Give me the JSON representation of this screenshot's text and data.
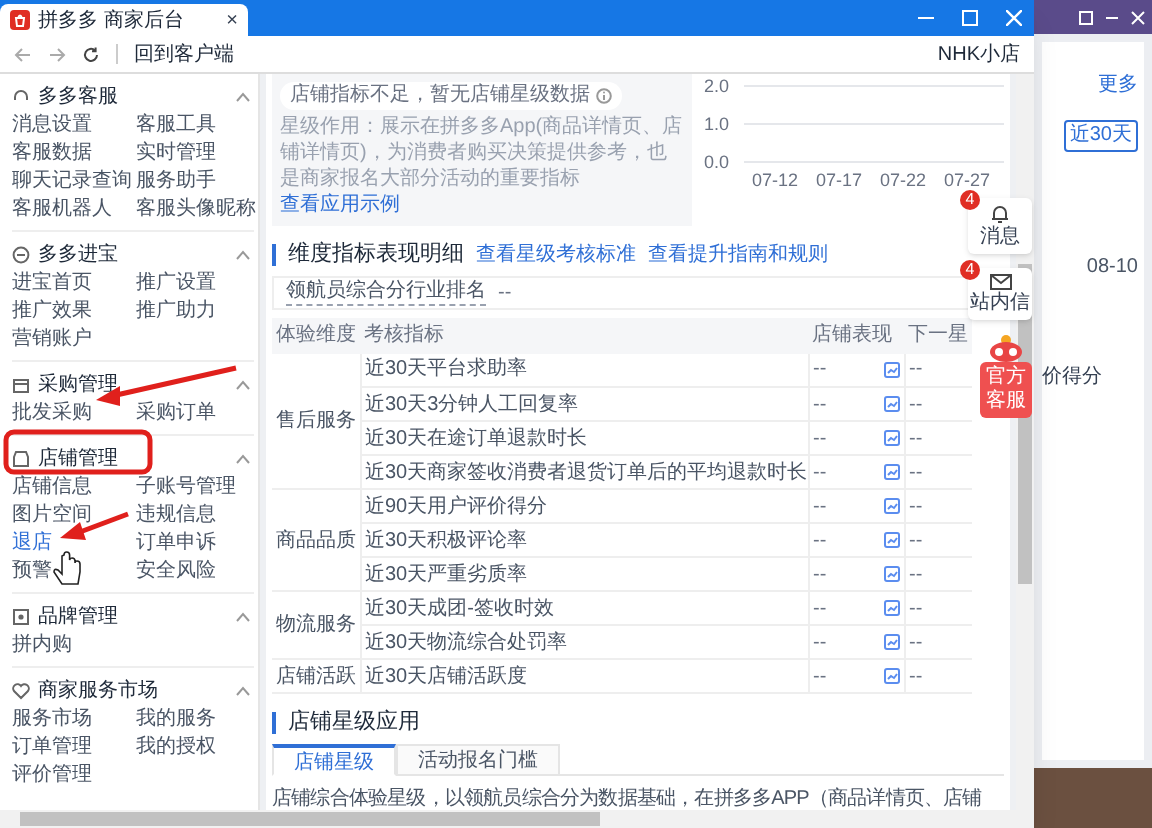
{
  "window": {
    "title": "拼多多 商家后台",
    "close": "×"
  },
  "toolbar": {
    "back_link": "回到客户端",
    "shop_name": "NHK小店"
  },
  "sidebar": {
    "sections": [
      {
        "title": "多多客服",
        "expanded": true,
        "items": [
          {
            "label": "消息设置",
            "selected": false
          },
          {
            "label": "客服工具",
            "selected": false
          },
          {
            "label": "客服数据",
            "selected": false
          },
          {
            "label": "实时管理",
            "selected": false
          },
          {
            "label": "聊天记录查询",
            "selected": false
          },
          {
            "label": "服务助手",
            "selected": false
          },
          {
            "label": "客服机器人",
            "selected": false
          },
          {
            "label": "客服头像昵称",
            "selected": false
          }
        ]
      },
      {
        "title": "多多进宝",
        "expanded": true,
        "items": [
          {
            "label": "进宝首页",
            "selected": false
          },
          {
            "label": "推广设置",
            "selected": false
          },
          {
            "label": "推广效果",
            "selected": false
          },
          {
            "label": "推广助力",
            "selected": false
          },
          {
            "label": "营销账户",
            "selected": false
          }
        ]
      },
      {
        "title": "采购管理",
        "expanded": true,
        "items": [
          {
            "label": "批发采购",
            "selected": false
          },
          {
            "label": "采购订单",
            "selected": false
          }
        ]
      },
      {
        "title": "店铺管理",
        "expanded": true,
        "items": [
          {
            "label": "店铺信息",
            "selected": false
          },
          {
            "label": "子账号管理",
            "selected": false
          },
          {
            "label": "图片空间",
            "selected": false
          },
          {
            "label": "违规信息",
            "selected": false
          },
          {
            "label": "退店",
            "selected": true
          },
          {
            "label": "订单申诉",
            "selected": false
          },
          {
            "label": "预警",
            "selected": false
          },
          {
            "label": "安全风险",
            "selected": false
          }
        ]
      },
      {
        "title": "品牌管理",
        "expanded": true,
        "items": [
          {
            "label": "拼内购",
            "selected": false
          }
        ]
      },
      {
        "title": "商家服务市场",
        "expanded": true,
        "items": [
          {
            "label": "服务市场",
            "selected": false
          },
          {
            "label": "我的服务",
            "selected": false
          },
          {
            "label": "订单管理",
            "selected": false
          },
          {
            "label": "我的授权",
            "selected": false
          },
          {
            "label": "评价管理",
            "selected": false
          }
        ]
      }
    ]
  },
  "star_panel": {
    "notice": "店铺指标不足，暂无店铺星级数据",
    "description": "星级作用：展示在拼多多App(商品详情页、店铺详情页)，为消费者购买决策提供参考，也是商家报名大部分活动的重要指标",
    "link": "查看应用示例",
    "chart_data": {
      "type": "line",
      "ylim": [
        0,
        2
      ],
      "categories": [
        "07-12",
        "07-17",
        "07-22",
        "07-27"
      ],
      "yticks": [
        {
          "value": 0,
          "label": "0.0"
        },
        {
          "value": 1,
          "label": "1.0"
        },
        {
          "value": 2,
          "label": "2.0"
        }
      ]
    }
  },
  "metrics": {
    "title": "维度指标表现明细",
    "links": [
      "查看星级考核标准",
      "查看提升指南和规则"
    ],
    "ranking_label": "领航员综合分行业排名",
    "ranking_value": "--",
    "columns": [
      "体验维度",
      "考核指标",
      "店铺表现",
      "下一星"
    ],
    "groups": [
      {
        "dimension": "售后服务",
        "rows": [
          {
            "metric": "近30天平台求助率",
            "value": "--",
            "next": "--"
          },
          {
            "metric": "近30天3分钟人工回复率",
            "value": "--",
            "next": "--"
          },
          {
            "metric": "近30天在途订单退款时长",
            "value": "--",
            "next": "--"
          },
          {
            "metric": "近30天商家签收消费者退货订单后的平均退款时长",
            "value": "--",
            "next": "--"
          }
        ]
      },
      {
        "dimension": "商品品质",
        "rows": [
          {
            "metric": "近90天用户评价得分",
            "value": "--",
            "next": "--"
          },
          {
            "metric": "近30天积极评论率",
            "value": "--",
            "next": "--"
          },
          {
            "metric": "近30天严重劣质率",
            "value": "--",
            "next": "--"
          }
        ]
      },
      {
        "dimension": "物流服务",
        "rows": [
          {
            "metric": "近30天成团-签收时效",
            "value": "--",
            "next": "--"
          },
          {
            "metric": "近30天物流综合处罚率",
            "value": "--",
            "next": "--"
          }
        ]
      },
      {
        "dimension": "店铺活跃",
        "rows": [
          {
            "metric": "近30天店铺活跃度",
            "value": "--",
            "next": "--"
          }
        ]
      }
    ]
  },
  "floating": [
    {
      "kind": "message",
      "label": "消息",
      "badge": "4"
    },
    {
      "kind": "mail",
      "label": "站内信",
      "badge": "4"
    },
    {
      "kind": "service",
      "label": "官方客服"
    }
  ],
  "app_section": {
    "title": "店铺星级应用",
    "tabs": [
      {
        "label": "店铺星级",
        "selected": true
      },
      {
        "label": "活动报名门槛",
        "selected": false
      }
    ],
    "text": "店铺综合体验星级，以领航员综合分为数据基础，在拼多多APP（商品详情页、店铺"
  },
  "background_window": {
    "more_link": "更多",
    "range_button": "近30天",
    "date": "08-10",
    "score_label": "价得分"
  }
}
